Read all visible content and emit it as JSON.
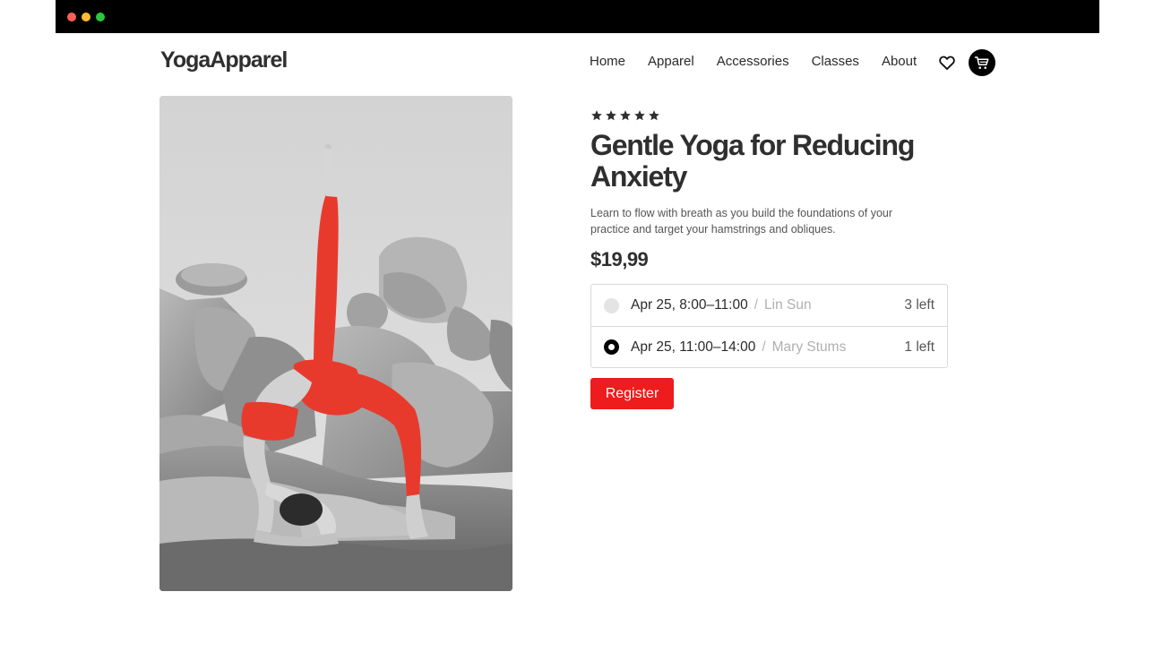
{
  "window": {
    "controls": [
      "close",
      "minimize",
      "maximize"
    ]
  },
  "header": {
    "logo": "YogaApparel",
    "nav": [
      "Home",
      "Apparel",
      "Accessories",
      "Classes",
      "About"
    ],
    "icons": [
      "heart-icon",
      "cart-icon"
    ]
  },
  "product": {
    "rating": 5,
    "title": "Gentle Yoga for Reducing Anxiety",
    "description": "Learn to flow with breath as you build the foundations of your practice and target your hamstrings and obliques.",
    "price": "$19,99",
    "sessions": [
      {
        "time": "Apr 25, 8:00–11:00",
        "separator": "/",
        "instructor": "Lin Sun",
        "availability": "3 left",
        "selected": false
      },
      {
        "time": "Apr 25, 11:00–14:00",
        "separator": "/",
        "instructor": "Mary Stums",
        "availability": "1 left",
        "selected": true
      }
    ],
    "register_label": "Register"
  },
  "colors": {
    "accent": "#ee1c1c",
    "leggings": "#e83a2c",
    "titlebar": "#000000"
  }
}
